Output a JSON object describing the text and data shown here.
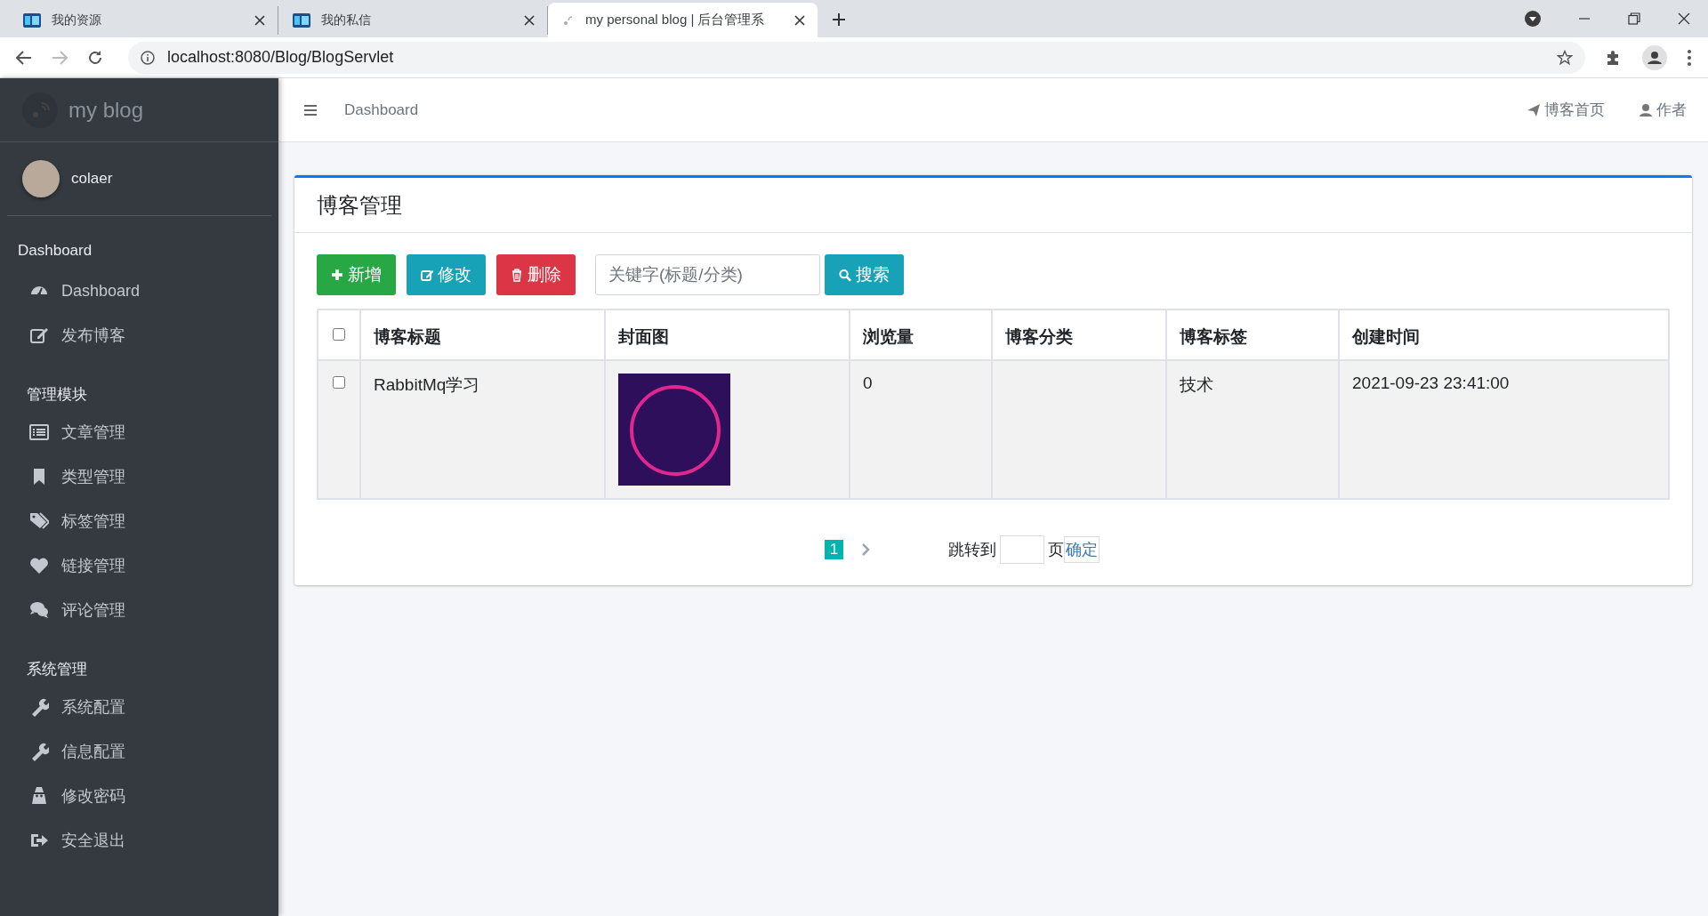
{
  "browser": {
    "tabs": [
      {
        "title": "我的资源",
        "selected": false
      },
      {
        "title": "我的私信",
        "selected": false
      },
      {
        "title": "my personal blog | 后台管理系",
        "selected": true
      }
    ],
    "url": "localhost:8080/Blog/BlogServlet"
  },
  "sidebar": {
    "brand": "my blog",
    "user": "colaer",
    "sections": [
      {
        "heading": "Dashboard",
        "items": [
          {
            "label": "Dashboard"
          },
          {
            "label": "发布博客"
          }
        ]
      },
      {
        "heading": "管理模块",
        "items": [
          {
            "label": "文章管理"
          },
          {
            "label": "类型管理"
          },
          {
            "label": "标签管理"
          },
          {
            "label": "链接管理"
          },
          {
            "label": "评论管理"
          }
        ]
      },
      {
        "heading": "系统管理",
        "items": [
          {
            "label": "系统配置"
          },
          {
            "label": "信息配置"
          },
          {
            "label": "修改密码"
          },
          {
            "label": "安全退出"
          }
        ]
      }
    ]
  },
  "header": {
    "breadcrumb": "Dashboard",
    "links": [
      {
        "label": "博客首页"
      },
      {
        "label": "作者"
      }
    ]
  },
  "panel": {
    "title": "博客管理",
    "buttons": [
      {
        "label": "新增",
        "kind": "add"
      },
      {
        "label": "修改",
        "kind": "edit"
      },
      {
        "label": "删除",
        "kind": "delete"
      }
    ],
    "search": {
      "placeholder": "关键字(标题/分类)",
      "button": "搜索"
    },
    "table": {
      "select_all": {
        "checked": false
      },
      "columns": [
        "博客标题",
        "封面图",
        "浏览量",
        "博客分类",
        "博客标签",
        "创建时间"
      ],
      "rows": [
        {
          "checked": false,
          "title": "RabbitMq学习",
          "views": "0",
          "tag": "技术",
          "created": "2021-09-23 23:41:00"
        }
      ]
    },
    "pagination": {
      "pages": [
        {
          "label": "1",
          "selected": true
        }
      ],
      "jump_label": "跳转到",
      "unit": "页",
      "confirm": "确定"
    }
  }
}
